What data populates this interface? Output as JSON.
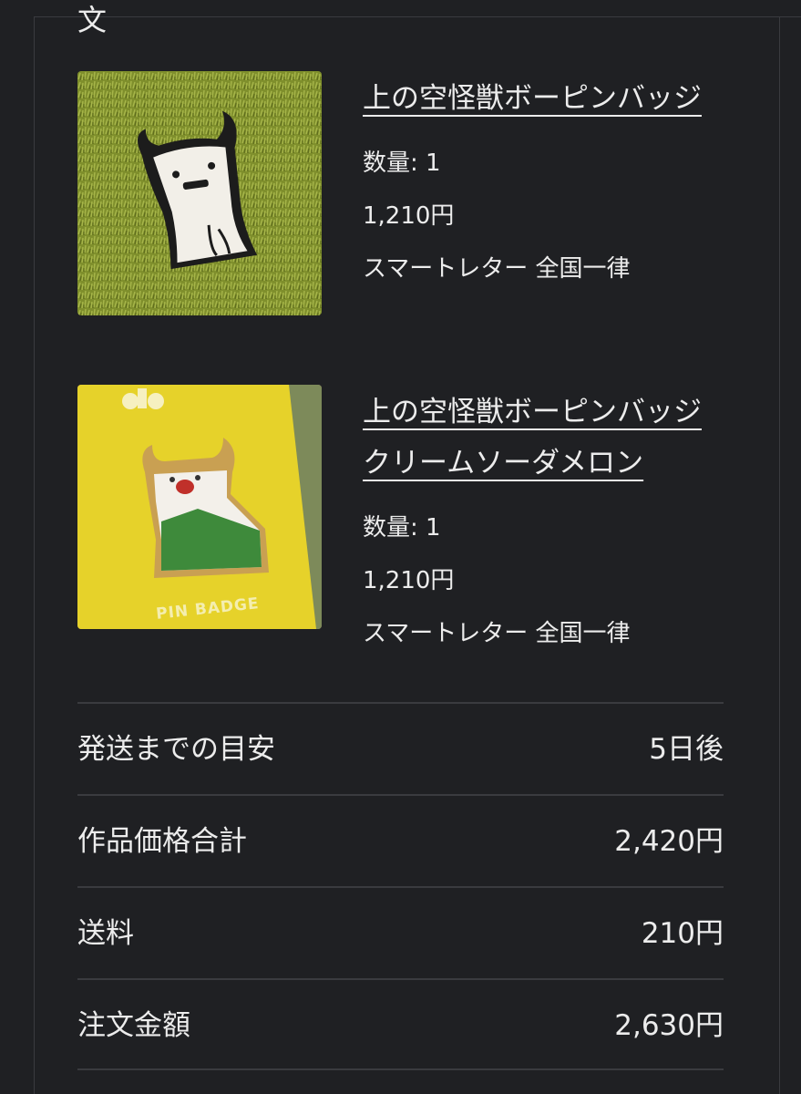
{
  "section": {
    "title": "文"
  },
  "items": [
    {
      "title": "上の空怪獣ボーピンバッジ",
      "quantity": "数量: 1",
      "price": "1,210円",
      "shipping": "スマートレター 全国一律"
    },
    {
      "title": "上の空怪獣ボーピンバッジクリームソーダメロン",
      "quantity": "数量: 1",
      "price": "1,210円",
      "shipping": "スマートレター 全国一律",
      "image_text": "PIN BADGE"
    }
  ],
  "summary": [
    {
      "label": "発送までの目安",
      "value": "5日後"
    },
    {
      "label": "作品価格合計",
      "value": "2,420円"
    },
    {
      "label": "送料",
      "value": "210円"
    },
    {
      "label": "注文金額",
      "value": "2,630円"
    }
  ],
  "colors": {
    "background": "#1f2023",
    "text": "#ececec",
    "divider": "#3a3b3f",
    "grass": "#7e8f2a",
    "card_yellow": "#e8d42a",
    "badge_green": "#3d8a3a"
  }
}
